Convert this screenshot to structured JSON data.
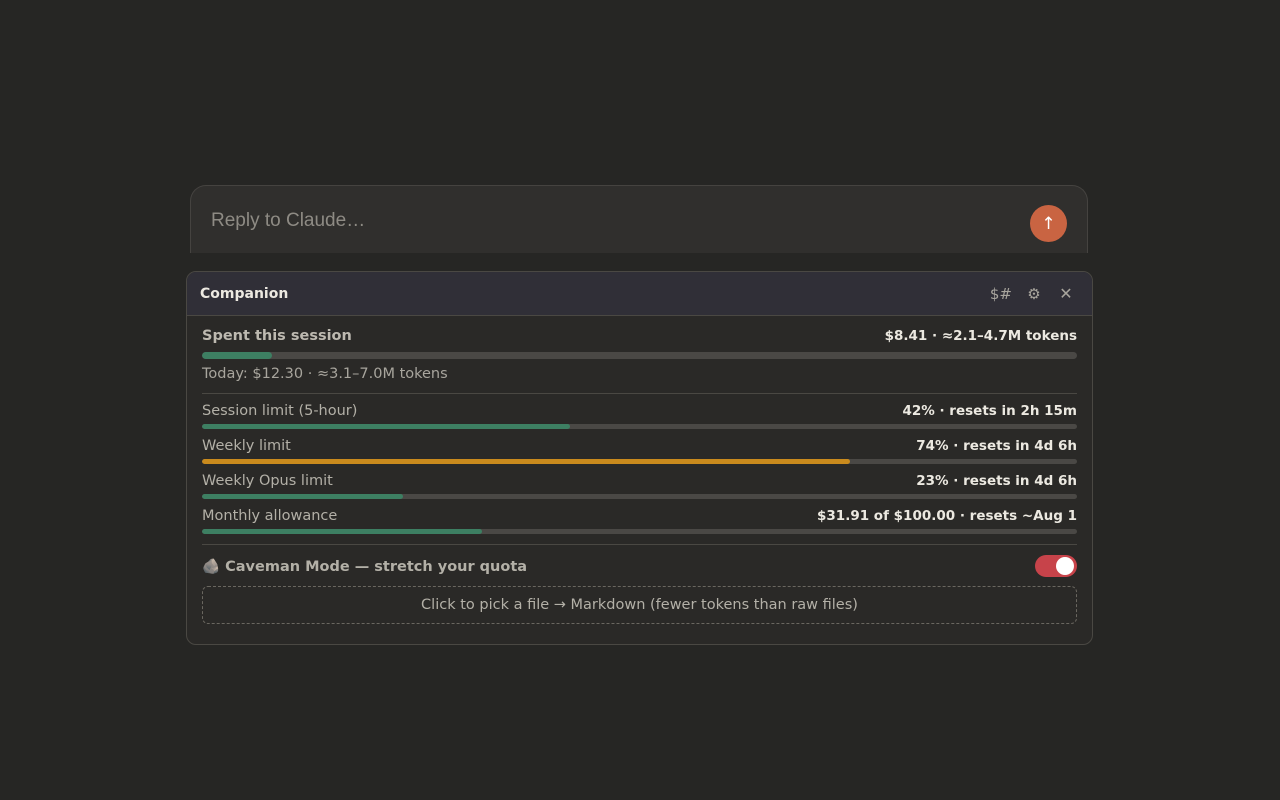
{
  "composer": {
    "placeholder": "Reply to Claude…",
    "send_icon": "↑",
    "send_color": "#c96442"
  },
  "companion": {
    "title": "Companion",
    "header_buttons": {
      "currency_label": "$#",
      "settings_icon": "⚙",
      "close_icon": "✕"
    },
    "session": {
      "title": "Spent this session",
      "value": "$8.41 · ≈2.1–4.7M tokens",
      "progress": 0.08,
      "today": "Today: $12.30 · ≈3.1–7.0M tokens"
    },
    "limits": [
      {
        "label": "Session limit (5-hour)",
        "value": "42% · resets in 2h 15m",
        "progress": 0.42,
        "color": "#3d7f62"
      },
      {
        "label": "Weekly limit",
        "value": "74% · resets in 4d 6h",
        "progress": 0.74,
        "color": "#c98a1d"
      },
      {
        "label": "Weekly Opus limit",
        "value": "23% · resets in 4d 6h",
        "progress": 0.23,
        "color": "#3d7f62"
      },
      {
        "label": "Monthly allowance",
        "value": "$31.91 of $100.00 · resets ~Aug 1",
        "progress": 0.32,
        "color": "#3d7f62"
      }
    ],
    "caveman": {
      "icon": "🪨",
      "label": "Caveman Mode — stretch your quota",
      "enabled": true,
      "toggle_color": "#c7434a"
    },
    "dropzone_label": "Click to pick a file → Markdown (fewer tokens than raw files)"
  },
  "colors": {
    "session_bar": "#3d7f62",
    "background": "#262624",
    "panel_header": "#302f37"
  }
}
